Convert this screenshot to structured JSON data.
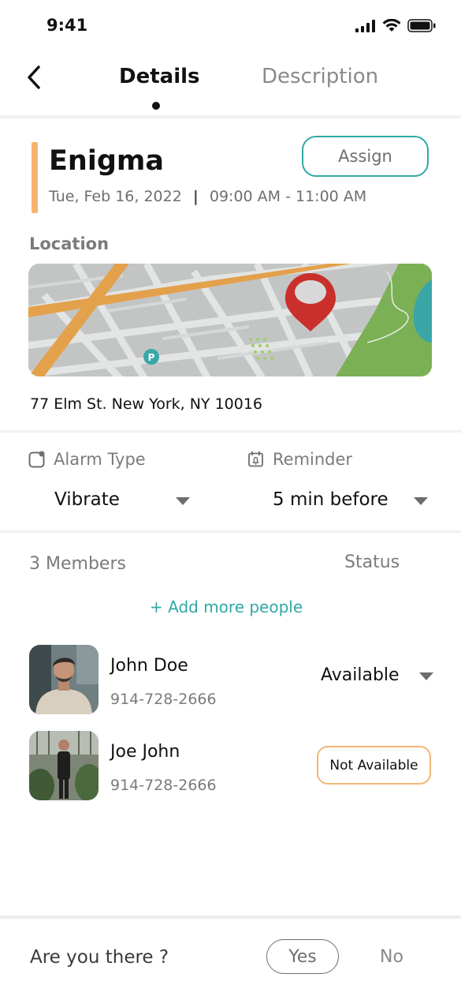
{
  "status_bar": {
    "time": "9:41"
  },
  "nav": {
    "tabs": [
      {
        "label": "Details",
        "active": true
      },
      {
        "label": "Description",
        "active": false
      }
    ]
  },
  "event": {
    "title": "Enigma",
    "date": "Tue, Feb 16, 2022",
    "separator": "|",
    "time_range": "09:00 AM - 11:00 AM",
    "assign_label": "Assign"
  },
  "location": {
    "label": "Location",
    "address": "77 Elm St. New York, NY 10016",
    "map_icon": "map-pin-icon"
  },
  "settings": {
    "alarm": {
      "label": "Alarm Type",
      "value": "Vibrate",
      "icon": "alarm-type-icon"
    },
    "reminder": {
      "label": "Reminder",
      "value": "5 min before",
      "icon": "calendar-bell-icon"
    }
  },
  "members": {
    "count_label": "3 Members",
    "status_header": "Status",
    "add_label": "+ Add more people",
    "list": [
      {
        "name": "John Doe",
        "phone": "914-728-2666",
        "status": "Available",
        "status_style": "dropdown"
      },
      {
        "name": "Joe John",
        "phone": "914-728-2666",
        "status": "Not Available",
        "status_style": "pill"
      }
    ]
  },
  "attendance": {
    "question": "Are you there ?",
    "yes_label": "Yes",
    "no_label": "No"
  },
  "colors": {
    "accent_teal": "#2fa9a5",
    "accent_orange": "#f7b26e",
    "text_primary": "#111111",
    "text_secondary": "#7b7b7b"
  }
}
